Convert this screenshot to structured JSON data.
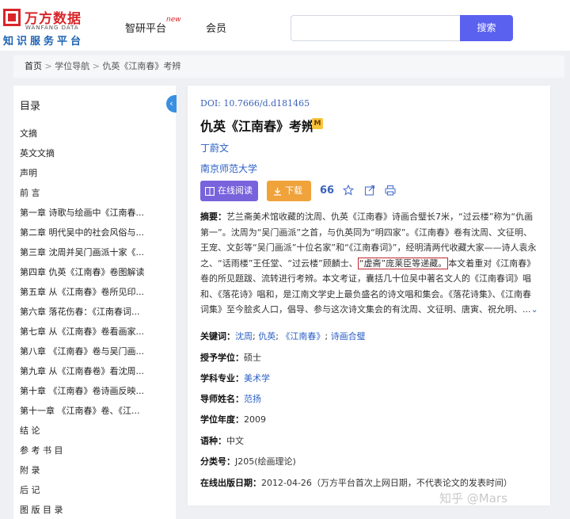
{
  "header": {
    "logo_cn": "万方数据",
    "logo_en": "WANFANG DATA",
    "logo_sub": "知识服务平台",
    "nav": [
      "智研平台",
      "会员"
    ],
    "nav_new_badge": "new",
    "search_value": "",
    "search_button": "搜索"
  },
  "breadcrumb": {
    "home": "首页",
    "sep": ">",
    "items": [
      "学位导航",
      "仇英《江南春》考辨"
    ]
  },
  "sidebar": {
    "title": "目录",
    "toggle_icon": "‹",
    "items": [
      "文摘",
      "英文文摘",
      "声明",
      "前 言",
      "第一章 诗歌与绘画中《江南春...",
      "第二章 明代吴中的社会风俗与...",
      "第三章 沈周并吴门画派十家《...",
      "第四章 仇英《江南春》卷图解读",
      "第五章 从《江南春》卷所见印...",
      "第六章 落花伤春：《江南春词...",
      "第七章 从《江南春》卷看画家...",
      "第八章 《江南春》卷与吴门画...",
      "第九章 从《江南春卷》看沈周...",
      "第十章 《江南春》卷诗画反映...",
      "第十一章 《江南春》卷、《江...",
      "结 论",
      "参 考 书 目",
      "附 录",
      "后 记",
      "图 版 目 录"
    ]
  },
  "record": {
    "doi": "DOI: 10.7666/d.d181465",
    "title": "仇英《江南春》考辨",
    "badge": "M",
    "author": "丁蔚文",
    "org": "南京师范大学",
    "read_button": "在线阅读",
    "download_button": "下载",
    "download_count": "66",
    "abstract_label": "摘要：",
    "abstract_pre": "艺兰斋美术馆收藏的沈周、仇英《江南春》诗画合璧长7米，“过云楼”称为“仇画第一”。沈周为“吴门画派”之首，与仇英同为“明四家”。《江南春》卷有沈周、文征明、王宠、文彭等“吴门画派”十位名家”和“《江南春词》”，经明清两代收藏大家——诗人袁永之、“话雨楼”王任堂、“过云楼”顾麟士、",
    "abstract_highlight": "“虚斋”庞莱臣等递藏。",
    "abstract_post": "本文着重对《江南春》卷的所见题跋、流转进行考辨。本文考证，囊括几十位吴中著名文人的《江南春词》唱和、《落花诗》唱和，是江南文学史上最负盛名的诗文唱和集会。《落花诗集》、《江南春词集》至今脍炙人口，倡导、参与这次诗文集会的有沈周、文征明、唐寅、祝允明、...",
    "more_icon": "chevron-down-icon",
    "fields": {
      "keywords_label": "关键词：",
      "keywords": [
        "沈周",
        "仇英",
        "《江南春》",
        "诗画合璧"
      ],
      "degree_label": "授予学位：",
      "degree": "硕士",
      "major_label": "学科专业：",
      "major": "美术学",
      "advisor_label": "导师姓名：",
      "advisor": "范扬",
      "year_label": "学位年度：",
      "year": "2009",
      "lang_label": "语种：",
      "lang": "中文",
      "class_label": "分类号：",
      "class": "J205(绘画理论)",
      "pubdate_label": "在线出版日期：",
      "pubdate": "2012-04-26",
      "pubdate_note": "（万方平台首次上网日期，不代表论文的发表时间）"
    }
  },
  "watermark": "知乎 @Mars",
  "colors": {
    "brand_red": "#d8262a",
    "search_purple": "#5b61ef",
    "read_purple": "#7863dc",
    "download_orange": "#f0a23b",
    "link_blue": "#2a5fc4"
  }
}
